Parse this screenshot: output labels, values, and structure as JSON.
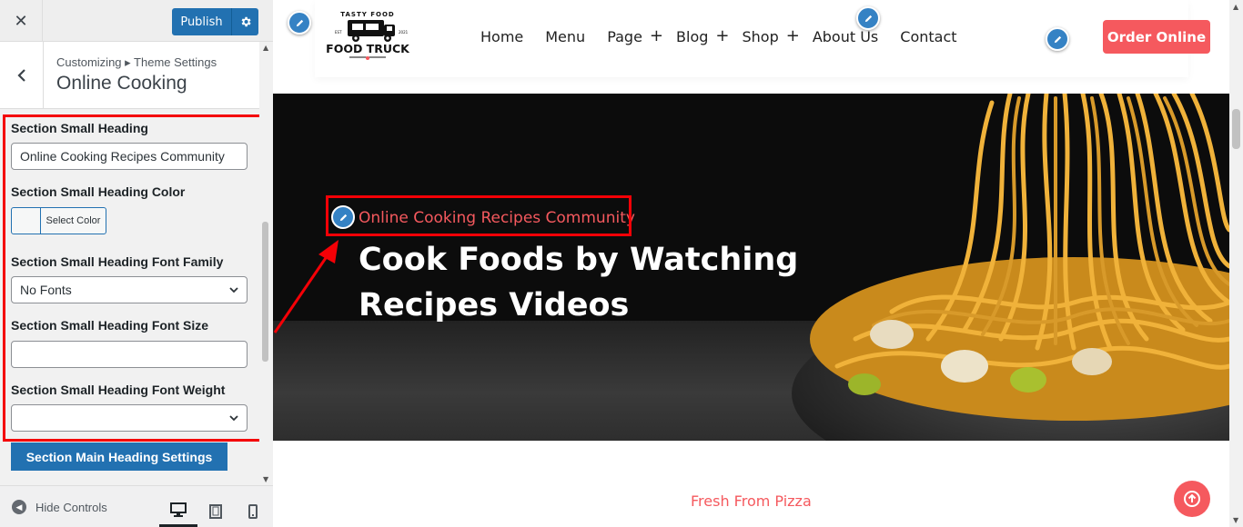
{
  "customizer": {
    "publish_label": "Publish",
    "breadcrumb": "Customizing ▸ Theme Settings",
    "section_title": "Online Cooking",
    "controls": {
      "small_heading_label": "Section Small Heading",
      "small_heading_value": "Online Cooking Recipes Community",
      "color_label": "Section Small Heading Color",
      "color_button": "Select Color",
      "font_family_label": "Section Small Heading Font Family",
      "font_family_value": "No Fonts",
      "font_size_label": "Section Small Heading Font Size",
      "font_size_value": "",
      "font_weight_label": "Section Small Heading Font Weight",
      "font_weight_value": ""
    },
    "main_heading_button": "Section Main Heading Settings",
    "hide_controls": "Hide Controls",
    "devices": [
      "desktop-icon",
      "tablet-icon",
      "mobile-icon"
    ],
    "active_device": "desktop"
  },
  "site": {
    "logo": {
      "top": "TASTY FOOD",
      "main": "FOOD TRUCK",
      "left_year": "EST",
      "right_year": "2021"
    },
    "nav": [
      {
        "label": "Home",
        "has_sub": false
      },
      {
        "label": "Menu",
        "has_sub": false
      },
      {
        "label": "Page",
        "has_sub": true
      },
      {
        "label": "Blog",
        "has_sub": true
      },
      {
        "label": "Shop",
        "has_sub": true
      },
      {
        "label": "About Us",
        "has_sub": false
      },
      {
        "label": "Contact",
        "has_sub": false
      }
    ],
    "order_button": "Order Online",
    "hero": {
      "small_heading": "Online Cooking Recipes Community",
      "title_line1": "Cook Foods by Watching",
      "title_line2": "Recipes Videos"
    },
    "next_section_small": "Fresh From Pizza"
  },
  "colors": {
    "accent": "#f5595e",
    "wp_blue": "#2271b1",
    "highlight_red": "#f40006"
  }
}
